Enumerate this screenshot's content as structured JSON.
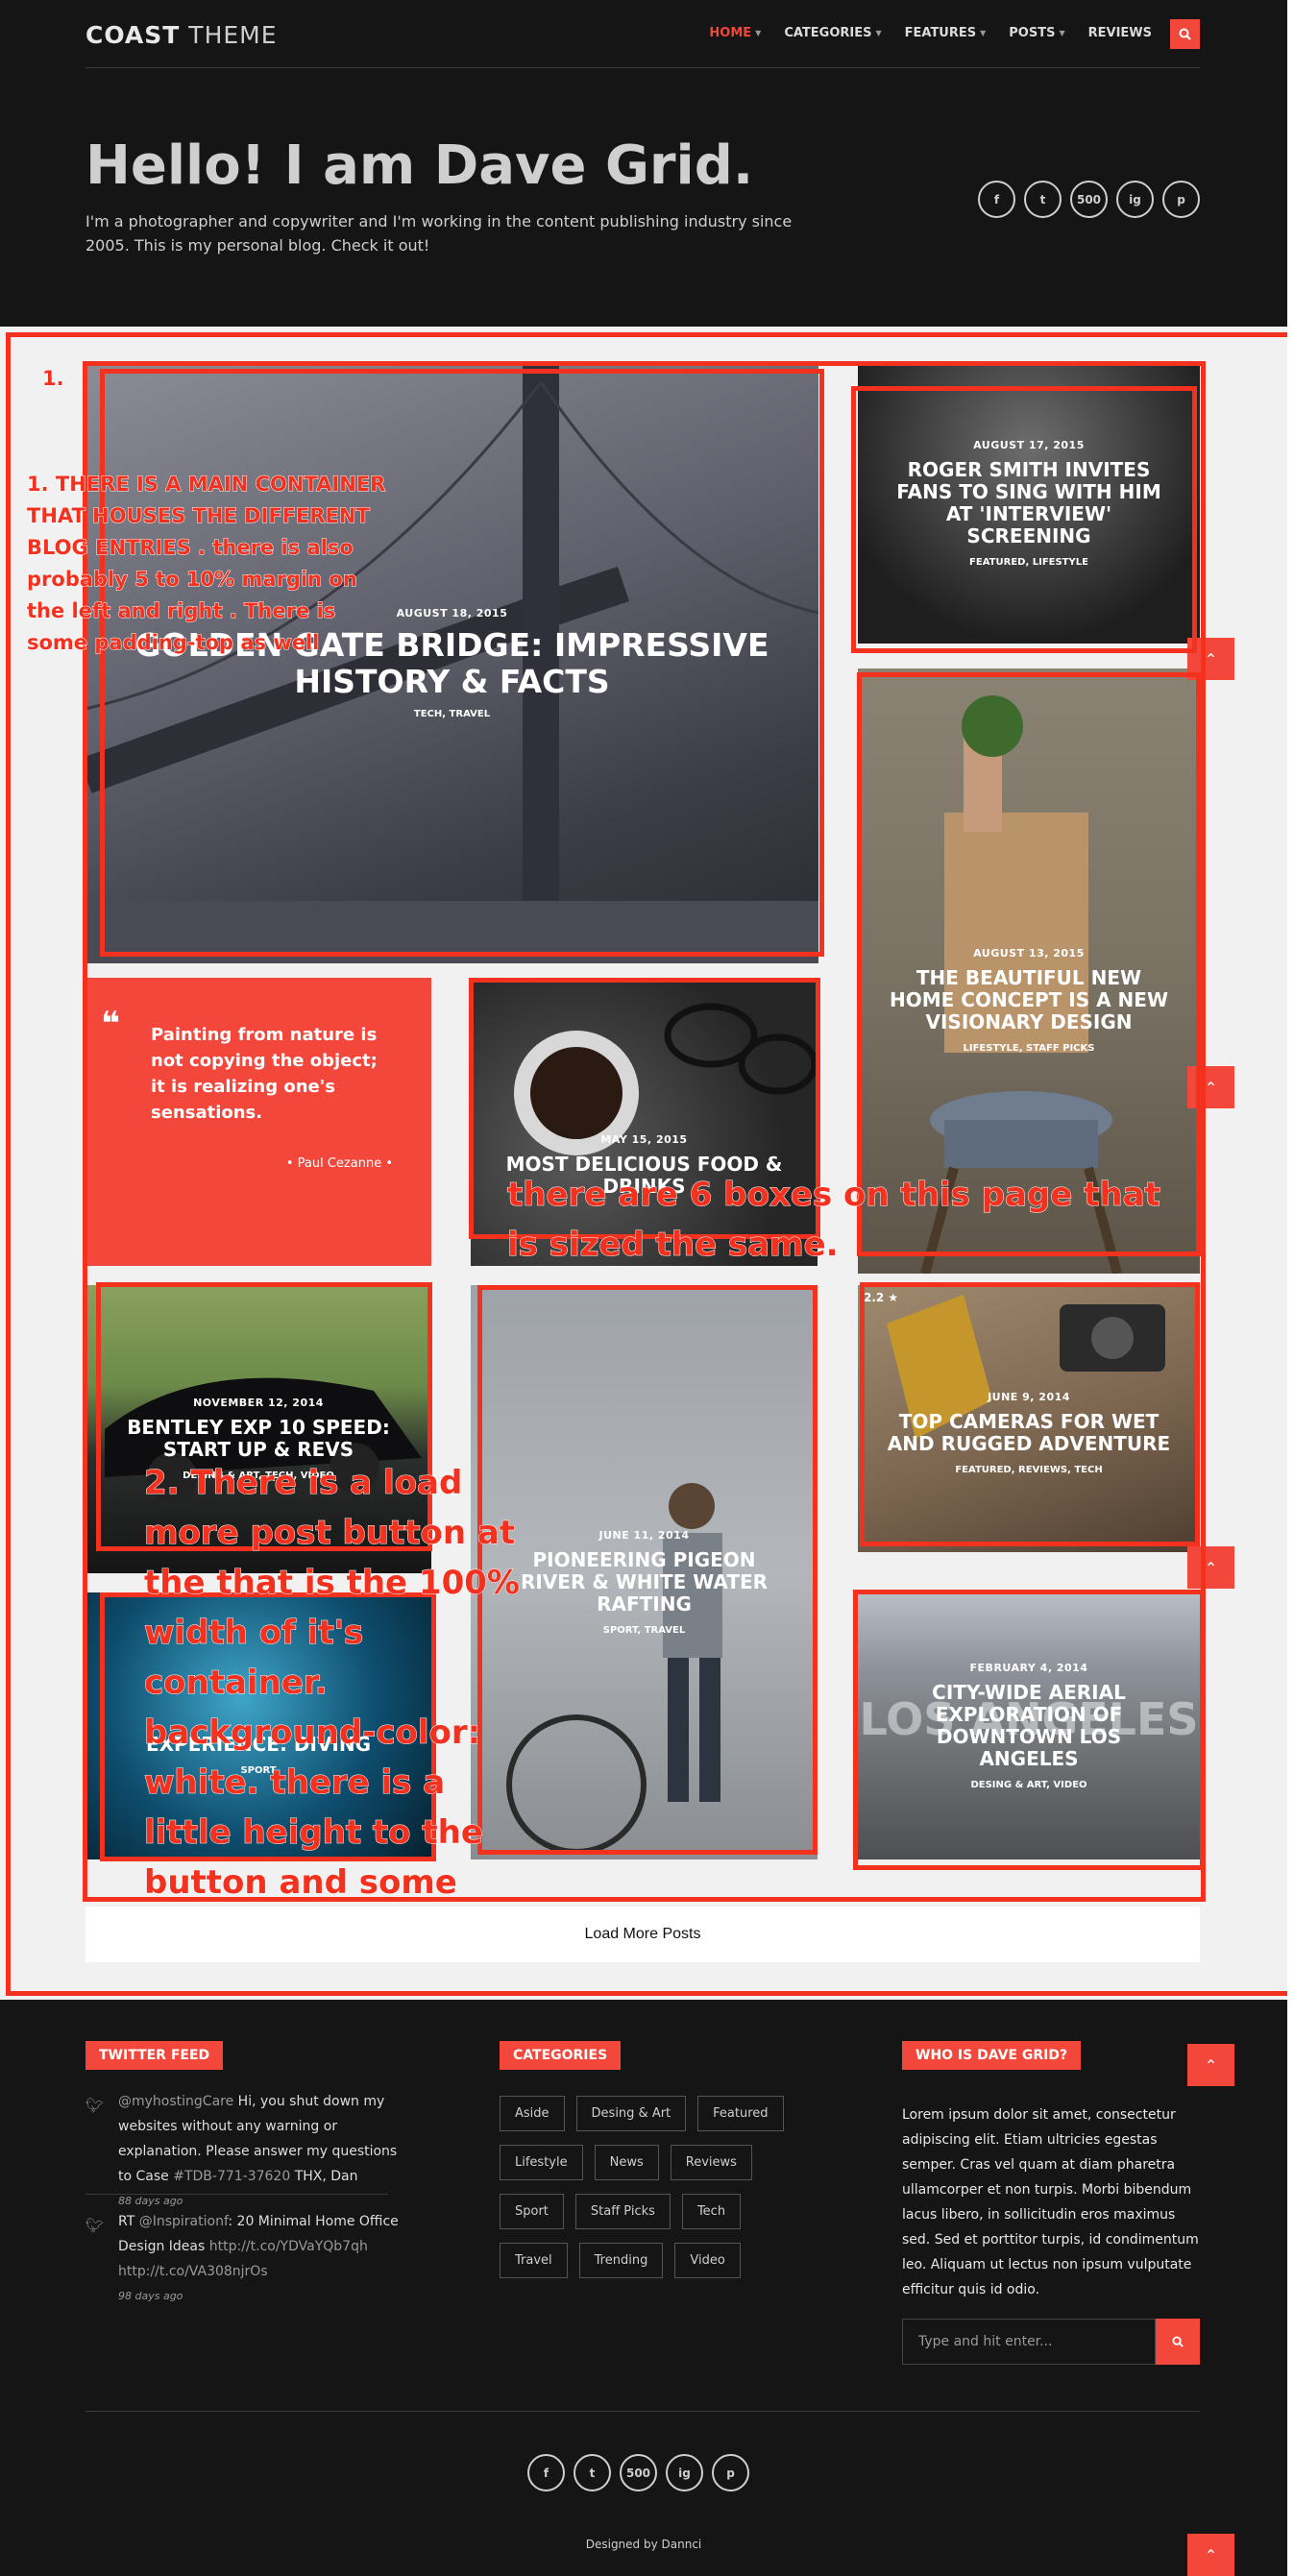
{
  "header": {
    "logo_bold": "COAST",
    "logo_light": "THEME",
    "nav": [
      {
        "label": "HOME",
        "active": true
      },
      {
        "label": "CATEGORIES",
        "active": false
      },
      {
        "label": "FEATURES",
        "active": false
      },
      {
        "label": "POSTS",
        "active": false
      },
      {
        "label": "REVIEWS",
        "active": false
      }
    ]
  },
  "hero": {
    "title": "Hello! I am Dave Grid.",
    "subtitle": "I'm a photographer and copywriter and I'm working in the content publishing industry since 2005. This is my personal blog. Check it out!",
    "social": [
      "f",
      "t",
      "500",
      "ig",
      "p"
    ]
  },
  "posts": {
    "golden_gate": {
      "date": "AUGUST 18, 2015",
      "title": "GOLDEN GATE BRIDGE: IMPRESSIVE HISTORY & FACTS",
      "cats": "TECH, TRAVEL"
    },
    "roger": {
      "date": "AUGUST 17, 2015",
      "title": "ROGER SMITH INVITES FANS TO SING WITH HIM AT 'INTERVIEW' SCREENING",
      "cats": "FEATURED, LIFESTYLE"
    },
    "home_concept": {
      "date": "AUGUST 13, 2015",
      "title": "THE BEAUTIFUL NEW HOME CONCEPT IS A NEW VISIONARY DESIGN",
      "cats": "LIFESTYLE, STAFF PICKS"
    },
    "food": {
      "date": "MAY 15, 2015",
      "title": "MOST DELICIOUS FOOD & DRINKS",
      "cats": ""
    },
    "bentley": {
      "date": "NOVEMBER 12, 2014",
      "title": "BENTLEY EXP 10 SPEED: START UP & REVS",
      "cats": "DESING & ART, TECH, VIDEO"
    },
    "pigeon": {
      "date": "JUNE 11, 2014",
      "title": "PIONEERING PIGEON RIVER & WHITE WATER RAFTING",
      "cats": "SPORT, TRAVEL"
    },
    "cameras": {
      "date": "JUNE 9, 2014",
      "title": "TOP CAMERAS FOR WET AND RUGGED ADVENTURE",
      "cats": "FEATURED, REVIEWS, TECH",
      "badge": "2.2 ★"
    },
    "diving": {
      "title": "EXPERIENCE: DIVING",
      "cats": "SPORT"
    },
    "los_angeles": {
      "date": "FEBRUARY 4, 2014",
      "title": "CITY-WIDE AERIAL EXPLORATION OF DOWNTOWN LOS ANGELES",
      "cats": "DESING & ART, VIDEO",
      "bg_text": "LOS ANGELES"
    }
  },
  "quote": {
    "text": "Painting from nature is not copying the object; it is realizing one's sensations.",
    "author": "• Paul Cezanne •"
  },
  "load_more": "Load More Posts",
  "annotations": {
    "num1": "1.",
    "note1": "1. THERE IS A MAIN CONTAINER THAT HOUSES THE DIFFERENT BLOG ENTRIES . there is also probably 5 to 10% margin on the left and right . There is some padding-top as well",
    "note_boxes": "there are 6 boxes on this page that is sized the same.",
    "note2": "2. There is a load more post button at the that is the 100% width of it's container. background-color: white. there is a little height to the button and some text in black",
    "num2": "2."
  },
  "footer": {
    "twitter_title": "TWITTER FEED",
    "tweets": [
      {
        "handle": "@myhostingCare",
        "text": " Hi, you shut down my websites without any warning or explanation. Please answer my questions to Case ",
        "link": "#TDB-771-37620",
        "tail": " THX, Dan",
        "ago": "88 days ago"
      },
      {
        "prefix": "RT ",
        "handle": "@Inspirationf",
        "text": ": 20 Minimal Home Office Design Ideas ",
        "link": "http://t.co/YDVaYQb7qh http://t.co/VA308njrOs",
        "ago": "98 days ago"
      }
    ],
    "categories_title": "CATEGORIES",
    "categories": [
      "Aside",
      "Desing & Art",
      "Featured",
      "Lifestyle",
      "News",
      "Reviews",
      "Sport",
      "Staff Picks",
      "Tech",
      "Travel",
      "Trending",
      "Video"
    ],
    "about_title": "WHO IS DAVE GRID?",
    "about_text": "Lorem ipsum dolor sit amet, consectetur adipiscing elit. Etiam ultricies egestas semper. Cras vel quam at diam pharetra ullamcorper et non turpis. Morbi bibendum lacus libero, in sollicitudin eros maximus sed. Sed et porttitor turpis, id condimentum leo. Aliquam ut lectus non ipsum vulputate efficitur quis id odio.",
    "search_placeholder": "Type and hit enter...",
    "credit": "Designed by Dannci"
  },
  "colors": {
    "accent": "#f2473a",
    "annotation": "#f2311f",
    "background": "#151515",
    "main_bg": "#f1f1f1"
  }
}
